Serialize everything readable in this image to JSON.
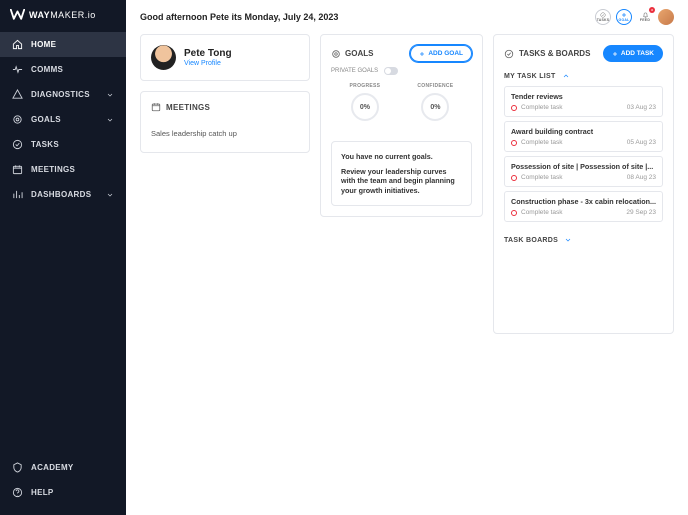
{
  "brand": {
    "name": "WAY",
    "suffix": "MAKER.io"
  },
  "greeting": "Good afternoon Pete its Monday, July 24, 2023",
  "topActions": {
    "tasks": "TASKS",
    "goal": "GOAL",
    "feed": "FEED",
    "feed_badge": "3"
  },
  "nav": {
    "items": [
      {
        "label": "HOME",
        "icon": "home",
        "active": true
      },
      {
        "label": "COMMS",
        "icon": "pulse"
      },
      {
        "label": "DIAGNOSTICS",
        "icon": "diag",
        "expandable": true
      },
      {
        "label": "GOALS",
        "icon": "target",
        "expandable": true
      },
      {
        "label": "TASKS",
        "icon": "check"
      },
      {
        "label": "MEETINGS",
        "icon": "calendar"
      },
      {
        "label": "DASHBOARDS",
        "icon": "chart",
        "expandable": true
      }
    ],
    "bottom": [
      {
        "label": "ACADEMY",
        "icon": "shield"
      },
      {
        "label": "HELP",
        "icon": "help"
      }
    ]
  },
  "profile": {
    "name": "Pete Tong",
    "view_link": "View Profile"
  },
  "meetings": {
    "title": "MEETINGS",
    "items": [
      "Sales leadership catch up"
    ]
  },
  "goals": {
    "title": "GOALS",
    "add_label": "ADD GOAL",
    "private_label": "PRIVATE GOALS",
    "metrics": {
      "progress_label": "PROGRESS",
      "progress_value": "0%",
      "confidence_label": "CONFIDENCE",
      "confidence_value": "0%"
    },
    "empty_line1": "You have no current goals.",
    "empty_line2": "Review your leadership curves with the team and begin planning your growth initiatives."
  },
  "tasks": {
    "title": "TASKS & BOARDS",
    "add_label": "ADD TASK",
    "my_list_label": "MY TASK LIST",
    "boards_label": "TASK BOARDS",
    "status_label": "Complete task",
    "items": [
      {
        "name": "Tender reviews",
        "date": "03 Aug 23"
      },
      {
        "name": "Award building contract",
        "date": "05 Aug 23"
      },
      {
        "name": "Possession of site | Possession of site |...",
        "date": "08 Aug 23"
      },
      {
        "name": "Construction phase - 3x cabin relocation...",
        "date": "29 Sep 23"
      }
    ]
  }
}
